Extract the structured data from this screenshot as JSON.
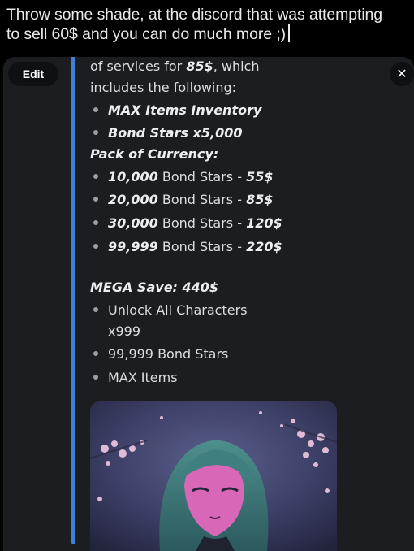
{
  "post": {
    "line1": "Throw some shade, at the discord that was attempting",
    "line2": "to sell 60$ and you can do much more ;)"
  },
  "media": {
    "edit_label": "Edit",
    "close_label": "✕",
    "accent_color": "#3f80d9"
  },
  "message": {
    "intro_prefix": "of services for ",
    "intro_price": "85$",
    "intro_suffix": ", which",
    "intro_line2": "includes the following:",
    "included": [
      "MAX Items Inventory",
      "Bond Stars x5,000"
    ],
    "currency_heading": "Pack of Currency:",
    "currency": [
      {
        "amount": "10,000",
        "unit": " Bond Stars - ",
        "price": "55$"
      },
      {
        "amount": "20,000",
        "unit": " Bond Stars - ",
        "price": "85$"
      },
      {
        "amount": "30,000",
        "unit": " Bond Stars - ",
        "price": "120$"
      },
      {
        "amount": "99,999",
        "unit": " Bond Stars - ",
        "price": "220$"
      }
    ],
    "mega_heading": "MEGA Save: 440$",
    "mega_items": [
      "Unlock All Characters",
      "x999",
      "99,999 Bond Stars",
      "MAX Items"
    ]
  }
}
